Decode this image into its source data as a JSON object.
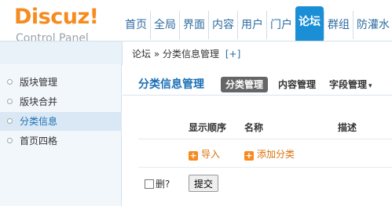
{
  "logo": {
    "name": "Discuz!",
    "subtitle": "Control Panel"
  },
  "topnav": [
    "首页",
    "全局",
    "界面",
    "内容",
    "用户",
    "门户",
    "论坛",
    "群组",
    "防灌水"
  ],
  "topnav_active_index": 6,
  "breadcrumb": {
    "parent": "论坛",
    "separator": "»",
    "current": "分类信息管理",
    "plus": "[+]"
  },
  "sidebar": {
    "items": [
      "版块管理",
      "版块合并",
      "分类信息",
      "首页四格"
    ],
    "active_index": 2
  },
  "main": {
    "title": "分类信息管理",
    "tabs": [
      {
        "label": "分类管理",
        "active": true
      },
      {
        "label": "内容管理",
        "active": false
      },
      {
        "label": "字段管理",
        "active": false,
        "dropdown": "▾"
      }
    ],
    "columns": [
      "显示顺序",
      "名称",
      "描述"
    ],
    "actions": {
      "import": "导入",
      "add": "添加分类"
    },
    "delete_label": "删?",
    "submit_label": "提交"
  },
  "colors": {
    "accent": "#1a8fd6",
    "logo": "#f68b1f",
    "link": "#1a6fb5",
    "action": "#d9710d"
  }
}
